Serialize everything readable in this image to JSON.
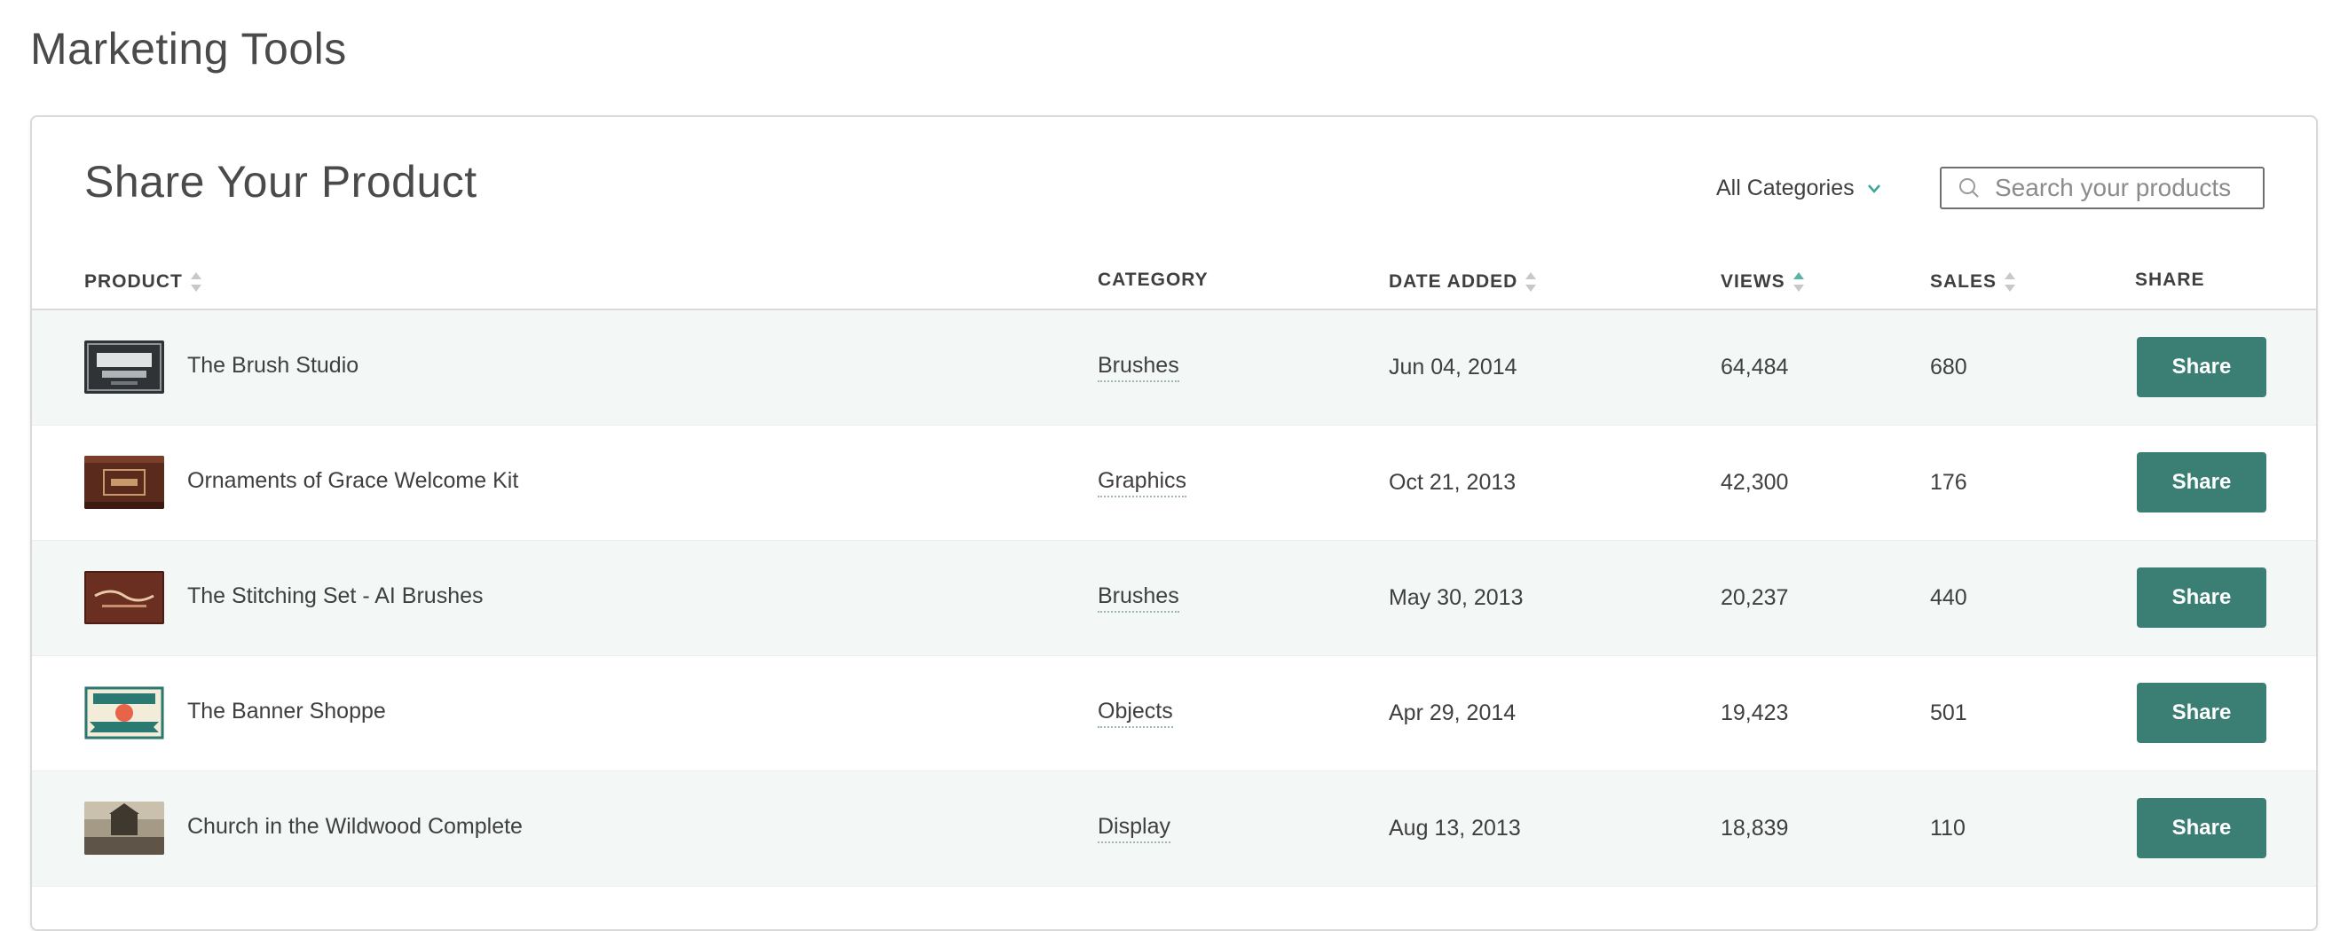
{
  "page": {
    "title": "Marketing Tools"
  },
  "panel": {
    "title": "Share Your Product",
    "category_filter": {
      "label": "All Categories",
      "icon": "chevron-down-icon"
    },
    "search": {
      "placeholder": "Search your products",
      "icon": "search-icon"
    }
  },
  "colors": {
    "accent": "#3b7f74",
    "sort_active": "#5bb3a6",
    "row_alt": "#f3f8f7"
  },
  "table": {
    "headers": {
      "product": "PRODUCT",
      "category": "CATEGORY",
      "date_added": "DATE ADDED",
      "views": "VIEWS",
      "sales": "SALES",
      "share": "SHARE"
    },
    "rows": [
      {
        "name": "The Brush Studio",
        "category": "Brushes",
        "date": "Jun 04, 2014",
        "views": "64,484",
        "sales": "680",
        "share_label": "Share"
      },
      {
        "name": "Ornaments of Grace Welcome Kit",
        "category": "Graphics",
        "date": "Oct 21, 2013",
        "views": "42,300",
        "sales": "176",
        "share_label": "Share"
      },
      {
        "name": "The Stitching Set - AI Brushes",
        "category": "Brushes",
        "date": "May 30, 2013",
        "views": "20,237",
        "sales": "440",
        "share_label": "Share"
      },
      {
        "name": "The Banner Shoppe",
        "category": "Objects",
        "date": "Apr 29, 2014",
        "views": "19,423",
        "sales": "501",
        "share_label": "Share"
      },
      {
        "name": "Church in the Wildwood Complete",
        "category": "Display",
        "date": "Aug 13, 2013",
        "views": "18,839",
        "sales": "110",
        "share_label": "Share"
      }
    ]
  }
}
